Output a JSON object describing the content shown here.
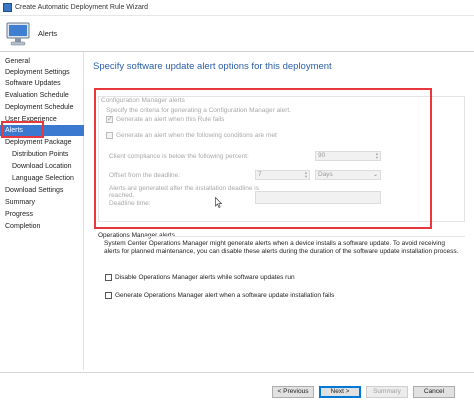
{
  "window": {
    "title": "Create Automatic Deployment Rule Wizard"
  },
  "header": {
    "page_name": "Alerts"
  },
  "nav": {
    "items": [
      {
        "label": "General",
        "sub": false,
        "active": false
      },
      {
        "label": "Deployment Settings",
        "sub": false,
        "active": false
      },
      {
        "label": "Software Updates",
        "sub": false,
        "active": false
      },
      {
        "label": "Evaluation Schedule",
        "sub": false,
        "active": false
      },
      {
        "label": "Deployment Schedule",
        "sub": false,
        "active": false
      },
      {
        "label": "User Experience",
        "sub": false,
        "active": false
      },
      {
        "label": "Alerts",
        "sub": false,
        "active": true
      },
      {
        "label": "Deployment Package",
        "sub": false,
        "active": false
      },
      {
        "label": "Distribution Points",
        "sub": true,
        "active": false
      },
      {
        "label": "Download Location",
        "sub": true,
        "active": false
      },
      {
        "label": "Language Selection",
        "sub": true,
        "active": false
      },
      {
        "label": "Download Settings",
        "sub": false,
        "active": false
      },
      {
        "label": "Summary",
        "sub": false,
        "active": false
      },
      {
        "label": "Progress",
        "sub": false,
        "active": false
      },
      {
        "label": "Completion",
        "sub": false,
        "active": false
      }
    ]
  },
  "content": {
    "title": "Specify software update alert options for this deployment",
    "cm_alerts": {
      "group_label": "Configuration Manager alerts",
      "criteria_text": "Specify the criteria for generating a Configuration Manager alert.",
      "rule_fails_label": "Generate an alert when this Rule fails",
      "rule_fails_checked": true,
      "conditions_label": "Generate an alert when the following conditions are met",
      "conditions_checked": false,
      "compliance_label": "Client compliance is below the following percent:",
      "compliance_value": "90",
      "offset_label": "Offset from the deadline:",
      "offset_value": "7",
      "offset_unit": "Days",
      "generated_after_label": "Alerts are generated after the installation deadline is reached.",
      "deadline_time_label": "Deadline time:",
      "deadline_time_value": ""
    },
    "om_alerts": {
      "group_label": "Operations Manager alerts",
      "description": "System Center Operations Manager might generate alerts when a device installs a software update. To avoid receiving alerts for planned maintenance, you can disable these alerts during the duration of the software update installation process.",
      "disable_label": "Disable Operations Manager alerts while software updates run",
      "disable_checked": false,
      "generate_fail_label": "Generate Operations Manager alert when a software update installation fails",
      "generate_fail_checked": false
    }
  },
  "footer": {
    "previous": "< Previous",
    "next": "Next >",
    "summary": "Summary",
    "cancel": "Cancel"
  }
}
